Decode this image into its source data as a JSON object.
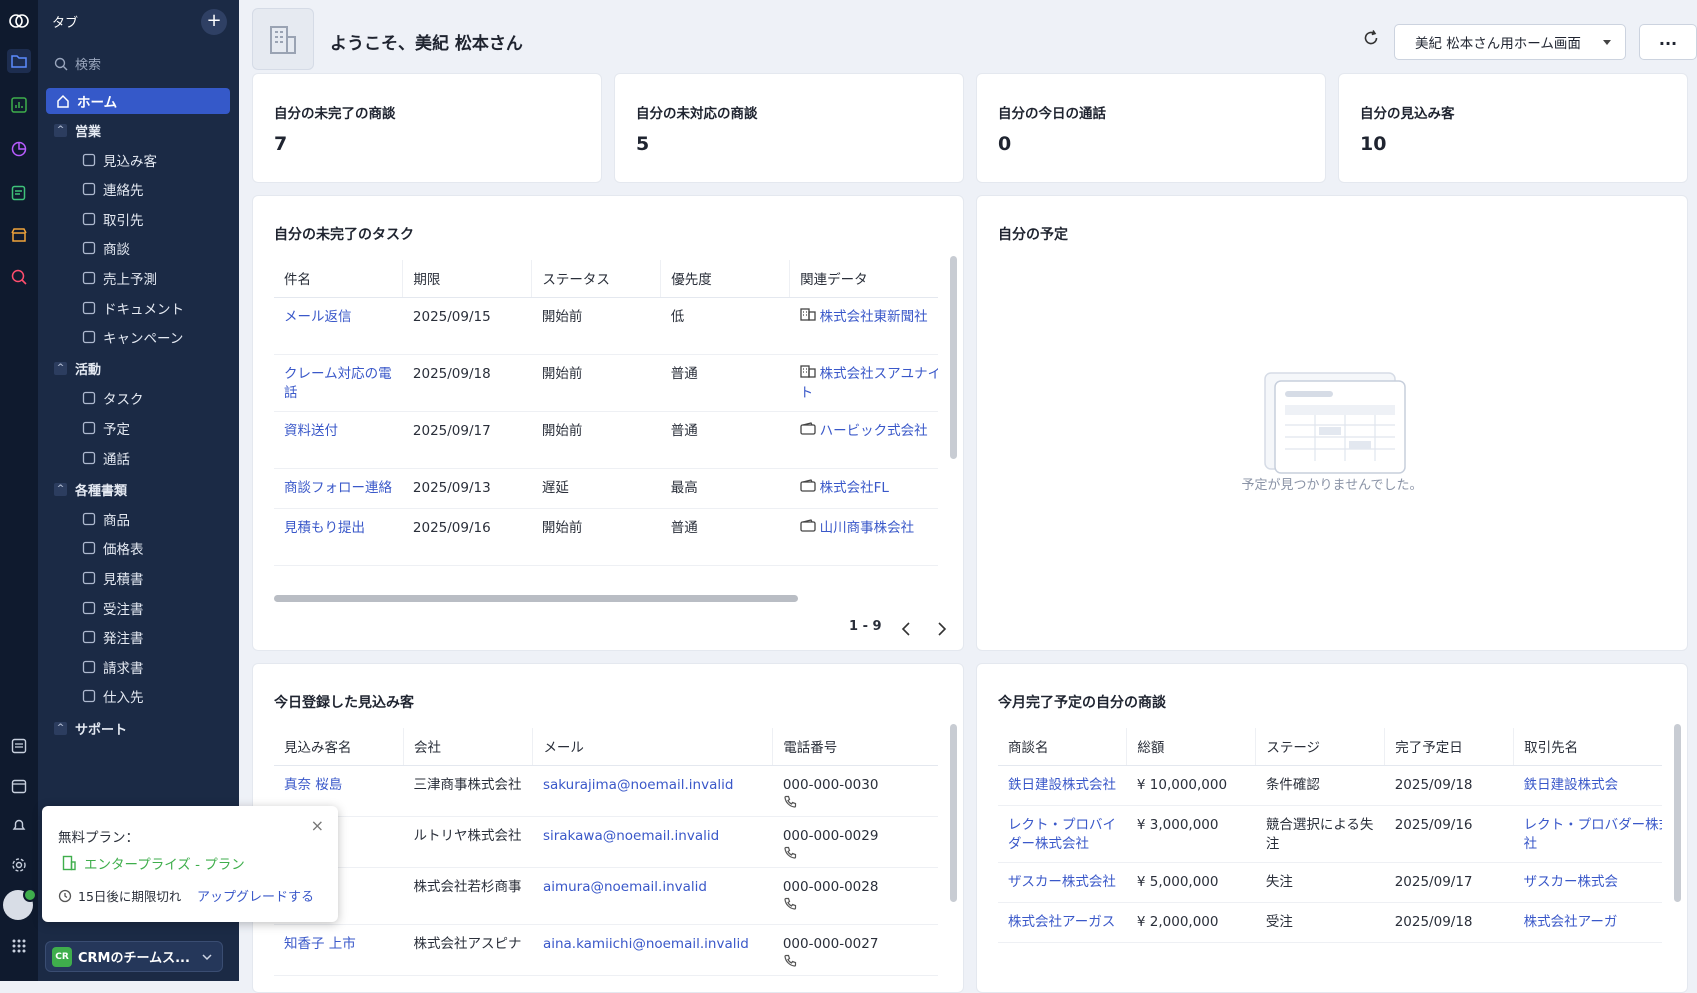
{
  "rail": {
    "icons": [
      "zoho-logo-icon",
      "crm-folder-icon",
      "analytics-icon",
      "pie-chart-icon",
      "notes-icon",
      "store-icon",
      "search-app-icon",
      "form-icon",
      "calendar-icon",
      "bell-icon",
      "gear-icon",
      "apps-grid-icon"
    ]
  },
  "sidebar": {
    "title": "タブ",
    "search_placeholder": "検索",
    "home": "ホーム",
    "groups": [
      {
        "label": "営業",
        "items": [
          "見込み客",
          "連絡先",
          "取引先",
          "商談",
          "売上予測",
          "ドキュメント",
          "キャンペーン"
        ]
      },
      {
        "label": "活動",
        "items": [
          "タスク",
          "予定",
          "通話"
        ]
      },
      {
        "label": "各種書類",
        "items": [
          "商品",
          "価格表",
          "見積書",
          "受注書",
          "発注書",
          "請求書",
          "仕入先"
        ]
      },
      {
        "label": "サポート",
        "items": []
      }
    ],
    "org": {
      "badge": "CR",
      "name": "CRMのチームス..."
    }
  },
  "header": {
    "welcome": "ようこそ、美紀 松本さん",
    "view_select": "美紀 松本さん用ホーム画面",
    "more": "..."
  },
  "stats": [
    {
      "label": "自分の未完了の商談",
      "value": "7"
    },
    {
      "label": "自分の未対応の商談",
      "value": "5"
    },
    {
      "label": "自分の今日の通話",
      "value": "0"
    },
    {
      "label": "自分の見込み客",
      "value": "10"
    }
  ],
  "tasks": {
    "title": "自分の未完了のタスク",
    "columns": [
      "件名",
      "期限",
      "ステータス",
      "優先度",
      "関連データ"
    ],
    "rows": [
      {
        "subject": "メール返信",
        "due": "2025/09/15",
        "status": "開始前",
        "priority": "低",
        "related": "株式会社東新聞社",
        "rel_icon": "building-icon"
      },
      {
        "subject": "クレーム対応の電話",
        "due": "2025/09/18",
        "status": "開始前",
        "priority": "普通",
        "related": "株式会社スアユナイテット",
        "rel_icon": "building-icon"
      },
      {
        "subject": "資料送付",
        "due": "2025/09/17",
        "status": "開始前",
        "priority": "普通",
        "related": "ハービック式会社",
        "rel_icon": "wallet-icon"
      },
      {
        "subject": "商談フォロー連絡",
        "due": "2025/09/13",
        "status": "遅延",
        "priority": "最高",
        "related": "株式会社FL",
        "rel_icon": "wallet-icon"
      },
      {
        "subject": "見積もり提出",
        "due": "2025/09/16",
        "status": "開始前",
        "priority": "普通",
        "related": "山川商事株会社",
        "rel_icon": "wallet-icon"
      }
    ],
    "pager": "1 - 9"
  },
  "schedule": {
    "title": "自分の予定",
    "empty": "予定が見つかりませんでした。"
  },
  "leads": {
    "title": "今日登録した見込み客",
    "columns": [
      "見込み客名",
      "会社",
      "メール",
      "電話番号"
    ],
    "rows": [
      {
        "name": "真奈 桜島",
        "company": "三津商事株式会社",
        "email": "sakurajima@noemail.invalid",
        "phone": "000-000-0030"
      },
      {
        "name": "",
        "company": "ルトリヤ株式会社",
        "email": "sirakawa@noemail.invalid",
        "phone": "000-000-0029"
      },
      {
        "name": "",
        "company": "株式会社若杉商事",
        "email": "aimura@noemail.invalid",
        "phone": "000-000-0028"
      },
      {
        "name": "知香子 上市",
        "company": "株式会社アスピナ",
        "email": "aina.kamiichi@noemail.invalid",
        "phone": "000-000-0027"
      }
    ]
  },
  "deals": {
    "title": "今月完了予定の自分の商談",
    "columns": [
      "商談名",
      "総額",
      "ステージ",
      "完了予定日",
      "取引先名"
    ],
    "rows": [
      {
        "name": "鉄日建設株式会社",
        "amount": "¥ 10,000,000",
        "stage": "条件確認",
        "date": "2025/09/18",
        "account": "鉄日建設株式会"
      },
      {
        "name": "レクト・プロバイダー株式会社",
        "amount": "¥ 3,000,000",
        "stage": "競合選択による失注",
        "date": "2025/09/16",
        "account": "レクト・プロバダー株式会社"
      },
      {
        "name": "ザスカー株式会社",
        "amount": "¥ 5,000,000",
        "stage": "失注",
        "date": "2025/09/17",
        "account": "ザスカー株式会"
      },
      {
        "name": "株式会社アーガス",
        "amount": "¥ 2,000,000",
        "stage": "受注",
        "date": "2025/09/18",
        "account": "株式会社アーガ"
      }
    ]
  },
  "popup": {
    "plan_label": "無料プラン：",
    "plan_name": "エンタープライズ - プラン",
    "expiry": "15日後に期限切れ",
    "upgrade": "アップグレードする",
    "close": "×"
  }
}
